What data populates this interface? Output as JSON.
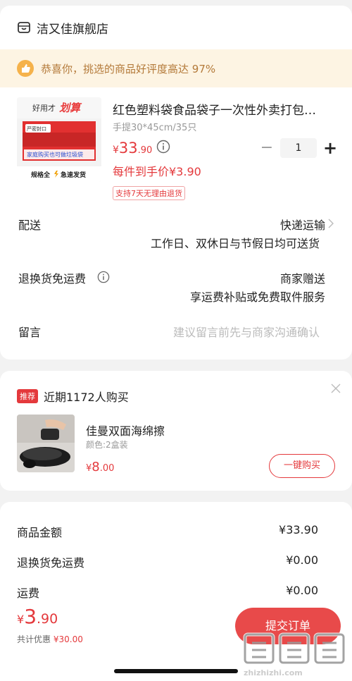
{
  "store": {
    "name": "洁又佳旗舰店"
  },
  "praise": {
    "text": "恭喜你，挑选的商品好评度高达 97%"
  },
  "product": {
    "title": "红色塑料袋食品袋子一次性外卖打包…",
    "spec": "手提30*45cm/35只",
    "price_currency": "¥",
    "price_int": "33",
    "price_dec": ".90",
    "quantity": "1",
    "hand_price": "每件到手价¥3.90",
    "return_tag": "支持7天无理由退货",
    "thumb": {
      "badge_top": "好用才",
      "badge_top_em": "划算",
      "seal": "严密封口",
      "caption": "家庭购买也可做垃圾袋",
      "bottom": "规格全",
      "bottom2": "急速发货"
    }
  },
  "delivery": {
    "label": "配送",
    "method": "快递运输",
    "detail": "工作日、双休日与节假日均可送货"
  },
  "return_ins": {
    "label": "退换货免运费",
    "value": "商家赠送",
    "detail": "享运费补贴或免费取件服务"
  },
  "message": {
    "label": "留言",
    "placeholder": "建议留言前先与商家沟通确认"
  },
  "recommend": {
    "tag": "推荐",
    "text": "近期1172人购买",
    "title": "佳曼双面海绵擦",
    "spec": "颜色:2盒装",
    "price_currency": "¥",
    "price_int": "8",
    "price_dec": ".00",
    "buy_label": "一键购买"
  },
  "summary": {
    "rows": [
      {
        "label": "商品金额",
        "value": "¥33.90"
      },
      {
        "label": "退换货免运费",
        "value": "¥0.00"
      },
      {
        "label": "运费",
        "value": "¥0.00"
      }
    ],
    "total_currency": "¥",
    "total_int": "3",
    "total_dec": ".90",
    "discount_label": "共计优惠",
    "discount_value": "¥30.00",
    "submit_label": "提交订单"
  },
  "watermark": {
    "text": "zhizhizhi.com"
  },
  "colors": {
    "accent": "#e4393c",
    "praise_bg": "#fdf4e3",
    "praise_text": "#b47a3a"
  }
}
